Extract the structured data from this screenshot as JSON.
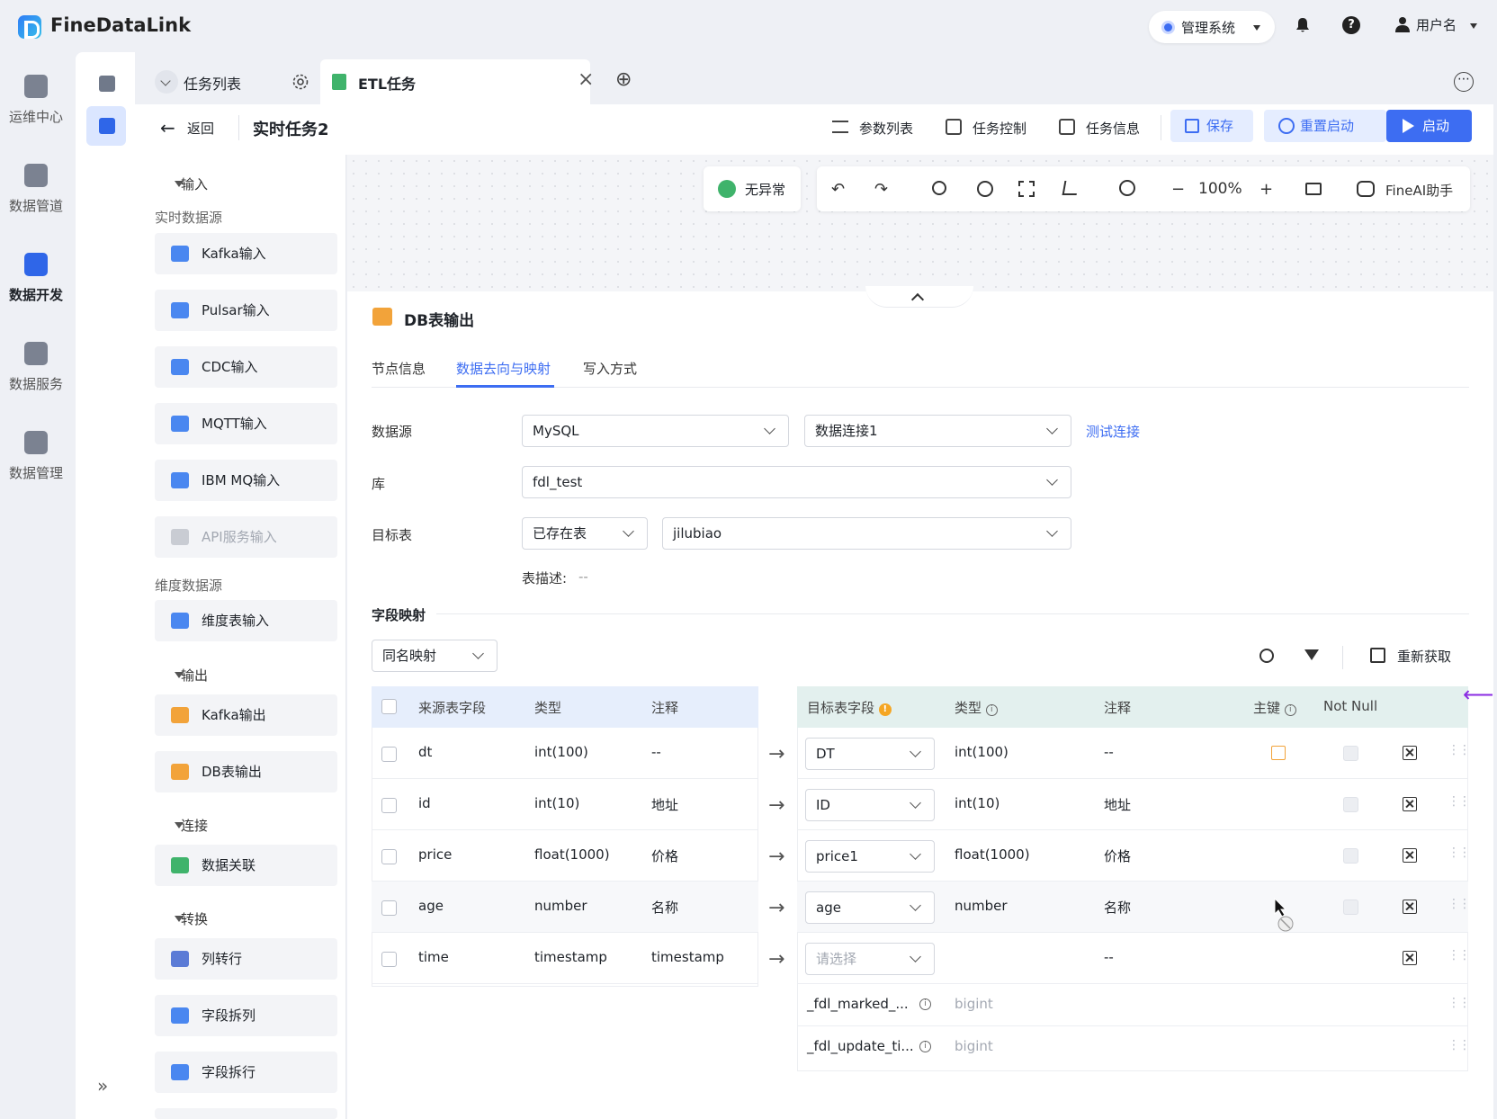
{
  "app": {
    "name": "FineDataLink"
  },
  "topbar": {
    "system_label": "管理系统",
    "user_label": "用户名",
    "help_glyph": "?"
  },
  "rail": {
    "items": [
      {
        "label": "运维中心",
        "icon": "ops-center-icon"
      },
      {
        "label": "数据管道",
        "icon": "pipeline-icon"
      },
      {
        "label": "数据开发",
        "icon": "dev-icon",
        "active": true
      },
      {
        "label": "数据服务",
        "icon": "service-icon"
      },
      {
        "label": "数据管理",
        "icon": "manage-icon"
      }
    ],
    "expand_glyph": "»"
  },
  "tabs": {
    "task_list": "任务列表",
    "etl": "ETL任务",
    "close_glyph": "×",
    "add_glyph": "⊕",
    "more_glyph": "⋯"
  },
  "header": {
    "back": "返回",
    "title": "实时任务2",
    "params": "参数列表",
    "control": "任务控制",
    "info": "任务信息",
    "save": "保存",
    "restart": "重置启动",
    "start": "启动"
  },
  "palette": {
    "input_section": "输入",
    "realtime_sub": "实时数据源",
    "realtime_nodes": [
      "Kafka输入",
      "Pulsar输入",
      "CDC输入",
      "MQTT输入",
      "IBM MQ输入",
      "API服务输入"
    ],
    "dim_sub": "维度数据源",
    "dim_nodes": [
      "维度表输入"
    ],
    "output_section": "输出",
    "output_nodes": [
      "Kafka输出",
      "DB表输出"
    ],
    "join_section": "连接",
    "join_nodes": [
      "数据关联"
    ],
    "transform_section": "转换",
    "transform_nodes": [
      "列转行",
      "字段拆列",
      "字段拆行"
    ]
  },
  "toolbar": {
    "status": "无异常",
    "zoom": "100%",
    "ai": "FineAI助手",
    "undo": "↶",
    "redo": "↷",
    "zoom_out": "−",
    "zoom_in": "+"
  },
  "detail": {
    "title": "DB表输出",
    "tabs": [
      "节点信息",
      "数据去向与映射",
      "写入方式"
    ],
    "datasource_label": "数据源",
    "datasource_type": "MySQL",
    "connection": "数据连接1",
    "test_link": "测试连接",
    "db_label": "库",
    "db_value": "fdl_test",
    "target_label": "目标表",
    "target_mode": "已存在表",
    "target_table": "jilubiao",
    "table_desc_label": "表描述:",
    "table_desc_value": "--",
    "mapping_title": "字段映射",
    "mapping_mode": "同名映射",
    "refresh": "重新获取"
  },
  "source_table": {
    "headers": [
      "来源表字段",
      "类型",
      "注释"
    ],
    "rows": [
      {
        "field": "dt",
        "type": "int(100)",
        "comment": "--"
      },
      {
        "field": "id",
        "type": "int(10)",
        "comment": "地址"
      },
      {
        "field": "price",
        "type": "float(1000)",
        "comment": "价格"
      },
      {
        "field": "age",
        "type": "number",
        "comment": "名称"
      },
      {
        "field": "time",
        "type": "timestamp",
        "comment": "timestamp"
      }
    ]
  },
  "target_table": {
    "headers": [
      "目标表字段",
      "类型",
      "注释",
      "主键",
      "Not Null"
    ],
    "warn_glyph": "!",
    "info_glyph": "i",
    "arrow_glyph": "→",
    "rows": [
      {
        "field": "DT",
        "type": "int(100)",
        "comment": "--",
        "placeholder": false
      },
      {
        "field": "ID",
        "type": "int(10)",
        "comment": "地址",
        "placeholder": false
      },
      {
        "field": "price1",
        "type": "float(1000)",
        "comment": "价格",
        "placeholder": false
      },
      {
        "field": "age",
        "type": "number",
        "comment": "名称",
        "placeholder": false
      },
      {
        "field": "请选择",
        "type": "",
        "comment": "--",
        "placeholder": true
      }
    ],
    "system_rows": [
      {
        "field": "_fdl_marked_...",
        "type": "bigint"
      },
      {
        "field": "_fdl_update_ti...",
        "type": "bigint"
      }
    ]
  },
  "colors": {
    "primary": "#3d6df2",
    "light": "#e5edff",
    "warn": "#f5a623",
    "purple": "#8a2be2"
  }
}
